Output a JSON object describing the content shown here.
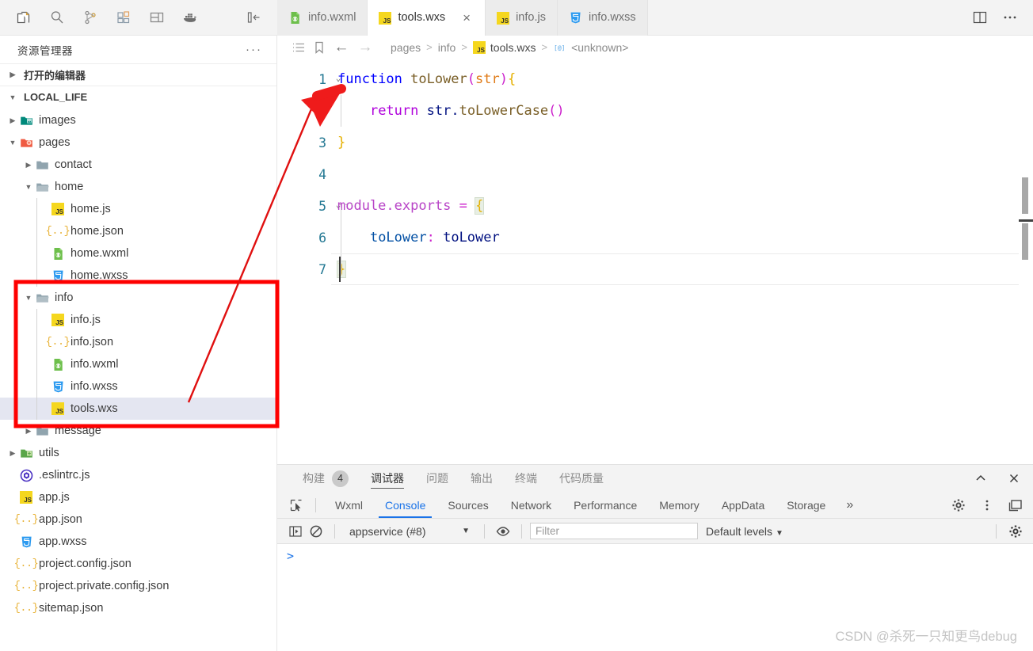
{
  "activity_bar": {
    "icons": [
      {
        "name": "explorer-icon",
        "glyph": "files"
      },
      {
        "name": "search-icon",
        "glyph": "search"
      },
      {
        "name": "source-control-icon",
        "glyph": "branch"
      },
      {
        "name": "extensions-icon",
        "glyph": "blocks"
      },
      {
        "name": "layout-icon",
        "glyph": "panel"
      },
      {
        "name": "docker-icon",
        "glyph": "docker"
      }
    ],
    "collapse": {
      "name": "collapse-sidebar-icon",
      "glyph": "collapse-left"
    }
  },
  "sidebar": {
    "title": "资源管理器",
    "more_label": "···",
    "sections": [
      {
        "label": "打开的编辑器",
        "expanded": false
      },
      {
        "label": "LOCAL_LIFE",
        "expanded": true
      }
    ],
    "tree": [
      {
        "label": "images",
        "depth": 1,
        "type": "folder-images",
        "expanded": false,
        "selected": false
      },
      {
        "label": "pages",
        "depth": 1,
        "type": "folder-pages",
        "expanded": true,
        "selected": false
      },
      {
        "label": "contact",
        "depth": 2,
        "type": "folder",
        "expanded": false,
        "selected": false
      },
      {
        "label": "home",
        "depth": 2,
        "type": "folder-open",
        "expanded": true,
        "selected": false
      },
      {
        "label": "home.js",
        "depth": 3,
        "type": "js",
        "selected": false
      },
      {
        "label": "home.json",
        "depth": 3,
        "type": "json",
        "selected": false
      },
      {
        "label": "home.wxml",
        "depth": 3,
        "type": "wxml",
        "selected": false
      },
      {
        "label": "home.wxss",
        "depth": 3,
        "type": "wxss",
        "selected": false
      },
      {
        "label": "info",
        "depth": 2,
        "type": "folder-open",
        "expanded": true,
        "selected": false
      },
      {
        "label": "info.js",
        "depth": 3,
        "type": "js",
        "selected": false
      },
      {
        "label": "info.json",
        "depth": 3,
        "type": "json",
        "selected": false
      },
      {
        "label": "info.wxml",
        "depth": 3,
        "type": "wxml",
        "selected": false
      },
      {
        "label": "info.wxss",
        "depth": 3,
        "type": "wxss",
        "selected": false
      },
      {
        "label": "tools.wxs",
        "depth": 3,
        "type": "js",
        "selected": true
      },
      {
        "label": "message",
        "depth": 2,
        "type": "folder",
        "expanded": false,
        "selected": false
      },
      {
        "label": "utils",
        "depth": 1,
        "type": "folder-utils",
        "expanded": false,
        "selected": false
      },
      {
        "label": ".eslintrc.js",
        "depth": 1,
        "type": "eslint",
        "selected": false
      },
      {
        "label": "app.js",
        "depth": 1,
        "type": "js",
        "selected": false
      },
      {
        "label": "app.json",
        "depth": 1,
        "type": "json",
        "selected": false
      },
      {
        "label": "app.wxss",
        "depth": 1,
        "type": "wxss",
        "selected": false
      },
      {
        "label": "project.config.json",
        "depth": 1,
        "type": "json",
        "selected": false
      },
      {
        "label": "project.private.config.json",
        "depth": 1,
        "type": "json",
        "selected": false
      },
      {
        "label": "sitemap.json",
        "depth": 1,
        "type": "json",
        "selected": false
      }
    ]
  },
  "tabs": [
    {
      "label": "info.wxml",
      "type": "wxml",
      "active": false,
      "closable": false
    },
    {
      "label": "tools.wxs",
      "type": "js",
      "active": true,
      "closable": true
    },
    {
      "label": "info.js",
      "type": "js",
      "active": false,
      "closable": false
    },
    {
      "label": "info.wxss",
      "type": "wxss",
      "active": false,
      "closable": false
    }
  ],
  "tab_actions": [
    {
      "name": "split-editor-icon",
      "glyph": "split"
    },
    {
      "name": "more-actions-icon",
      "glyph": "ellipsis"
    }
  ],
  "breadcrumb": {
    "icons": [
      {
        "name": "outline-icon",
        "glyph": "list"
      },
      {
        "name": "bookmark-icon",
        "glyph": "bookmark"
      }
    ],
    "back": "←",
    "forward": "→",
    "segments": [
      {
        "label": "pages",
        "icon": "none",
        "strong": false
      },
      {
        "label": "info",
        "icon": "none",
        "strong": false
      },
      {
        "label": "tools.wxs",
        "icon": "js",
        "strong": true
      },
      {
        "label": "<unknown>",
        "icon": "symbol",
        "strong": false
      }
    ],
    "separator": ">"
  },
  "editor": {
    "language": "javascript",
    "lines": [
      {
        "num": "1",
        "folding": "open",
        "tokens": [
          {
            "t": "function ",
            "c": "k-blue"
          },
          {
            "t": "toLower",
            "c": "k-fn"
          },
          {
            "t": "(",
            "c": "k-paren"
          },
          {
            "t": "str",
            "c": "k-param"
          },
          {
            "t": ")",
            "c": "k-paren"
          },
          {
            "t": "{",
            "c": "k-brace"
          }
        ]
      },
      {
        "num": "2",
        "folding": "",
        "indent_guide": true,
        "tokens": [
          {
            "t": "    ",
            "c": ""
          },
          {
            "t": "return ",
            "c": "k-purple"
          },
          {
            "t": "str",
            "c": "k-var"
          },
          {
            "t": ".",
            "c": "k-var"
          },
          {
            "t": "toLowerCase",
            "c": "k-fn"
          },
          {
            "t": "(",
            "c": "k-paren"
          },
          {
            "t": ")",
            "c": "k-paren"
          }
        ]
      },
      {
        "num": "3",
        "folding": "",
        "tokens": [
          {
            "t": "}",
            "c": "k-brace"
          }
        ]
      },
      {
        "num": "4",
        "folding": "",
        "tokens": []
      },
      {
        "num": "5",
        "folding": "open",
        "tokens": [
          {
            "t": "module",
            "c": "k-mod"
          },
          {
            "t": ".",
            "c": "k-mod"
          },
          {
            "t": "exports",
            "c": "k-mod"
          },
          {
            "t": " ",
            "c": ""
          },
          {
            "t": "=",
            "c": "k-paren"
          },
          {
            "t": " ",
            "c": ""
          },
          {
            "t": "{",
            "c": "k-brace brmatch"
          }
        ]
      },
      {
        "num": "6",
        "folding": "",
        "indent_guide": true,
        "tokens": [
          {
            "t": "    ",
            "c": ""
          },
          {
            "t": "toLower",
            "c": "k-prop"
          },
          {
            "t": ": ",
            "c": "k-paren"
          },
          {
            "t": "toLower",
            "c": "k-var"
          }
        ]
      },
      {
        "num": "7",
        "folding": "",
        "tokens": [
          {
            "t": "}",
            "c": "k-brace brmatch"
          }
        ]
      }
    ]
  },
  "devtools": {
    "panel_tabs": [
      {
        "label": "构建",
        "badge": "4",
        "active": false
      },
      {
        "label": "调试器",
        "badge": "",
        "active": true
      },
      {
        "label": "问题",
        "badge": "",
        "active": false
      },
      {
        "label": "输出",
        "badge": "",
        "active": false
      },
      {
        "label": "终端",
        "badge": "",
        "active": false
      },
      {
        "label": "代码质量",
        "badge": "",
        "active": false
      }
    ],
    "panel_actions": [
      {
        "name": "maximize-panel-icon",
        "glyph": "chevron-up"
      },
      {
        "name": "close-panel-icon",
        "glyph": "close"
      }
    ],
    "inspect_icon": "inspect-element-icon",
    "tabs": [
      {
        "label": "Wxml",
        "active": false
      },
      {
        "label": "Console",
        "active": true
      },
      {
        "label": "Sources",
        "active": false
      },
      {
        "label": "Network",
        "active": false
      },
      {
        "label": "Performance",
        "active": false
      },
      {
        "label": "Memory",
        "active": false
      },
      {
        "label": "AppData",
        "active": false
      },
      {
        "label": "Storage",
        "active": false
      }
    ],
    "more_tabs": "»",
    "tabbar_actions": [
      {
        "name": "devtools-settings-icon",
        "glyph": "gear"
      },
      {
        "name": "devtools-menu-icon",
        "glyph": "kebab"
      },
      {
        "name": "dock-side-icon",
        "glyph": "dock"
      }
    ],
    "filterbar": {
      "sidebar_toggle": "console-sidebar-icon",
      "clear_icon": "clear-console-icon",
      "context": "appservice (#8)",
      "context_caret": "▼",
      "eye_icon": "live-expression-icon",
      "filter_value": "",
      "filter_placeholder": "Filter",
      "levels": "Default levels",
      "levels_caret": "▼",
      "settings_icon": "console-settings-icon"
    },
    "console_prompt": ">"
  },
  "watermark": "CSDN @杀死一只知更鸟debug",
  "annotations": {
    "box_color": "#ff0000",
    "arrow_color": "#ee1111"
  },
  "colors": {
    "accent_blue": "#1a73e8",
    "line_number": "#237893",
    "selection": "#e4e6f1"
  }
}
